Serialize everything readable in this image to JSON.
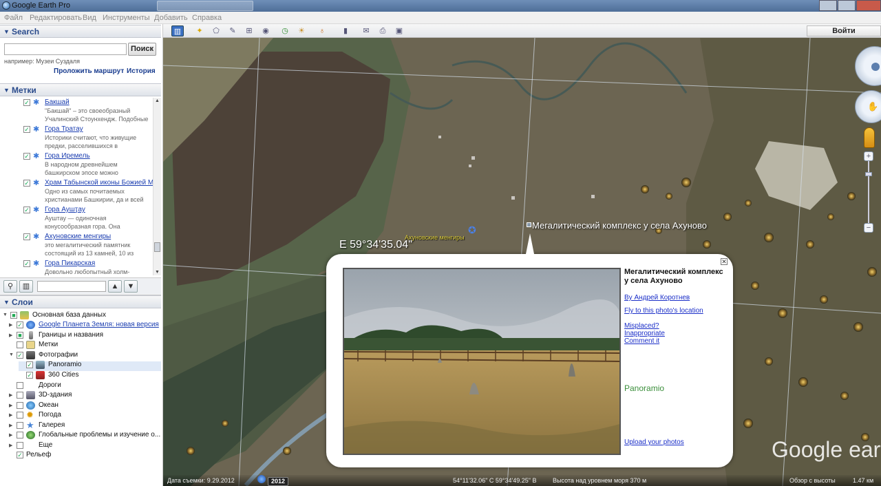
{
  "window": {
    "title": "Google Earth Pro"
  },
  "menu": [
    "Файл",
    "Редактировать",
    "Вид",
    "Инструменты",
    "Добавить",
    "Справка"
  ],
  "search": {
    "header": "Search",
    "button": "Поиск",
    "example": "например: Музеи Суздаля",
    "route_link": "Проложить маршрут",
    "history_link": "История"
  },
  "places": {
    "header": "Метки",
    "items": [
      {
        "name": "Бакшай",
        "desc1": "\"Бакшай\" – это своеобразный",
        "desc2": "Учалинский Стоунхендж. Подобные"
      },
      {
        "name": "Гора Тратау",
        "desc1": "Историки считают, что живущие",
        "desc2": "предки, расселившихся в"
      },
      {
        "name": "Гора Иремель",
        "desc1": "В народном древнейшем",
        "desc2": "башкирском эпосе можно"
      },
      {
        "name": "Храм Табынской иконы Божией М",
        "desc1": "Одно из самых почитаемых",
        "desc2": "христианами Башкирии, да и всей"
      },
      {
        "name": "Гора Аушҭау",
        "desc1": "Ауштау — одиночная",
        "desc2": "конусообразная гора. Она"
      },
      {
        "name": "Ахуновские менгиры",
        "desc1": "это мегалитический памятник",
        "desc2": "состоящий из 13 камней, 10 из"
      },
      {
        "name": "Гора Пикарская",
        "desc1": "Довольно любопытный холм-",
        "desc2": ""
      }
    ]
  },
  "layers": {
    "header": "Слои",
    "items": [
      {
        "label": "Основная база данных",
        "checked": "■"
      },
      {
        "label": "Google Планета Земля: новая версия",
        "checked": "✓"
      },
      {
        "label": "Границы и названия",
        "checked": "■"
      },
      {
        "label": "Метки",
        "checked": ""
      },
      {
        "label": "Фотографии",
        "checked": "✓"
      },
      {
        "label": "Panoramio",
        "checked": "✓"
      },
      {
        "label": "360 Cities",
        "checked": "✓"
      },
      {
        "label": "Дороги",
        "checked": ""
      },
      {
        "label": "3D-здания",
        "checked": ""
      },
      {
        "label": "Океан",
        "checked": ""
      },
      {
        "label": "Погода",
        "checked": ""
      },
      {
        "label": "Галерея",
        "checked": ""
      },
      {
        "label": "Глобальные проблемы и изучение о...",
        "checked": ""
      },
      {
        "label": "Еще",
        "checked": ""
      },
      {
        "label": "Рельеф",
        "checked": "✓"
      }
    ]
  },
  "toolbar": {
    "login": "Войти"
  },
  "map": {
    "coord_label": "E 59°34'35.04\"",
    "menhir_label": "Ахуновские менгиры",
    "placemark_label": "Мегалитический комплекс у села Ахуново",
    "watermark": "Google earth"
  },
  "balloon": {
    "title": "Мегалитический комплекс у села Ахуново",
    "author": "By Андрей Коротнев",
    "fly": "Fly to this photo's location",
    "misplaced": "Misplaced?",
    "inappropriate": "Inappropriate",
    "comment": "Comment it",
    "logo": "Panoramio",
    "upload": "Upload your photos"
  },
  "status": {
    "date": "Дата съемки: 9.29.2012",
    "year": "2012",
    "coords": "54°11'32.06\" С  59°34'49.25\" В",
    "elevation": "Высота над уровнем моря   370 м",
    "eye": "Обзор с высоты",
    "eye_value": "1.47 км"
  },
  "colors": {
    "accent": "#2a4b8c",
    "link": "#1a3db0"
  }
}
